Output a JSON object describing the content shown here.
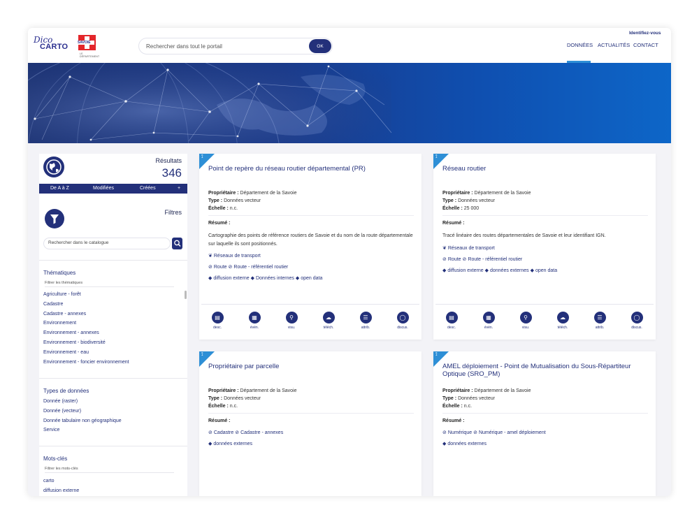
{
  "header": {
    "logo": {
      "dico": "Dico",
      "carto": "CARTO",
      "crest_text": "SAVOIE",
      "dept": "LE DÉPARTEMENT"
    },
    "search_placeholder": "Rechercher dans tout le portail",
    "search_button": "OK",
    "login_link": "Identifiez-vous",
    "nav": [
      "DONNÉES",
      "ACTUALITÉS",
      "CONTACT"
    ],
    "active_nav": "DONNÉES"
  },
  "sidebar": {
    "results_label": "Résultats",
    "results_count": "346",
    "sort": [
      "De A à Z",
      "Modifiées",
      "Créées",
      "+"
    ],
    "filters_label": "Filtres",
    "catalog_search_placeholder": "Rechercher dans le catalogue",
    "thematiques": {
      "title": "Thématiques",
      "filter_placeholder": "Filtrer les thématiques",
      "items": [
        "Agriculture - forêt",
        "Cadastre",
        "Cadastre - annexes",
        "Environnement",
        "Environnement - annexes",
        "Environnement - biodiversité",
        "Environnement - eau",
        "Environnement - foncier environnement"
      ]
    },
    "types": {
      "title": "Types de données",
      "items": [
        "Donnée (raster)",
        "Donnée (vecteur)",
        "Donnée tabulaire non géographique",
        "Service"
      ]
    },
    "keywords": {
      "title": "Mots-clés",
      "filter_placeholder": "Filtrer les mots-clés",
      "items": [
        "carto",
        "diffusion externe"
      ]
    }
  },
  "labels": {
    "owner": "Propriétaire :",
    "type": "Type :",
    "scale": "Échelle :",
    "summary": "Résumé :"
  },
  "actions": [
    "desc.",
    "évén.",
    "visu.",
    "téléch.",
    "attrib.",
    "discus."
  ],
  "cards": [
    {
      "title": "Point de repère du réseau routier départemental (PR)",
      "owner": "Département de la Savoie",
      "type": "Données vecteur",
      "scale": "n.c.",
      "summary": "Cartographie des points de référence routiers de Savoie et du nom de la route départementale sur laquelle ils sont positionnés.",
      "tags_theme": [
        "Réseaux de transport"
      ],
      "tags_cat": [
        "Route",
        "Route - référentiel routier"
      ],
      "tags_kw": [
        "diffusion externe",
        "Données internes",
        "open data"
      ]
    },
    {
      "title": "Réseau routier",
      "owner": "Département de la Savoie",
      "type": "Données vecteur",
      "scale": "25 000",
      "summary": "Tracé linéaire des routes départementales de Savoie et leur identifiant IGN.",
      "tags_theme": [
        "Réseaux de transport"
      ],
      "tags_cat": [
        "Route",
        "Route - référentiel routier"
      ],
      "tags_kw": [
        "diffusion externe",
        "données externes",
        "open data"
      ]
    },
    {
      "title": "Propriétaire par parcelle",
      "owner": "Département de la Savoie",
      "type": "Données vecteur",
      "scale": "n.c.",
      "tags_cat": [
        "Cadastre",
        "Cadastre - annexes"
      ],
      "tags_kw": [
        "données externes"
      ]
    },
    {
      "title": "AMEL déploiement - Point de Mutualisation du Sous-Répartiteur Optique (SRO_PM)",
      "owner": "Département de la Savoie",
      "type": "Données vecteur",
      "scale": "n.c.",
      "tags_cat": [
        "Numérique",
        "Numérique - amel déploiement"
      ],
      "tags_kw": [
        "données externes"
      ]
    }
  ],
  "colors": {
    "primary": "#23307a",
    "accent": "#2e8fd6",
    "background": "#f3f3f7"
  }
}
